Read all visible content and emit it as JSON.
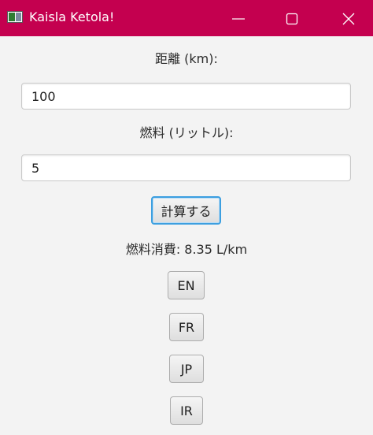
{
  "window": {
    "title": "Kaisla Ketola!",
    "accent_color": "#c4004f",
    "icons": [
      "app-icon",
      "minimize-icon",
      "maximize-icon",
      "close-icon"
    ]
  },
  "form": {
    "distance_label": "距離 (km):",
    "distance_value": "100",
    "fuel_label": "燃料 (リットル):",
    "fuel_value": "5",
    "calculate_label": "計算する",
    "result_text": "燃料消費: 8.35 L/km"
  },
  "languages": [
    {
      "label": "EN"
    },
    {
      "label": "FR"
    },
    {
      "label": "JP"
    },
    {
      "label": "IR"
    }
  ]
}
